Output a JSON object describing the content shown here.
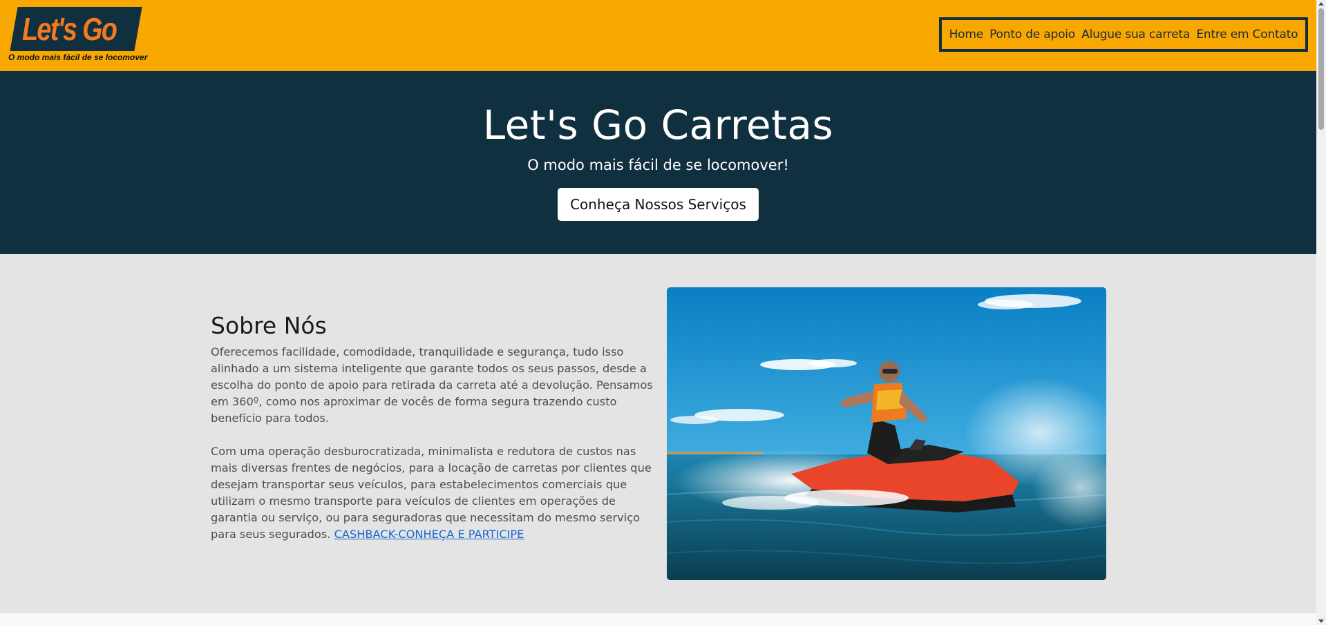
{
  "brand": {
    "logo_text": "Let's Go",
    "logo_tagline": "O modo mais fácil de se locomover",
    "colors": {
      "header_bg": "#f8a800",
      "dark": "#10303f",
      "logo_orange": "#f47a20",
      "section_bg": "#e4e4e4",
      "link": "#1967d2"
    }
  },
  "nav": {
    "items": [
      {
        "label": "Home"
      },
      {
        "label": "Ponto de apoio"
      },
      {
        "label": "Alugue sua carreta"
      },
      {
        "label": "Entre em Contato"
      }
    ]
  },
  "hero": {
    "title": "Let's Go Carretas",
    "subtitle": "O modo mais fácil de se locomover!",
    "cta_label": "Conheça Nossos Serviços"
  },
  "about": {
    "heading": "Sobre Nós",
    "paragraph_1": "Oferecemos facilidade, comodidade, tranquilidade e segurança, tudo isso alinhado a um sistema inteligente que garante todos os seus passos, desde a escolha do ponto de apoio para retirada da carreta até a devolução. Pensamos em 360º, como nos aproximar de vocês de forma segura trazendo custo benefício para todos.",
    "paragraph_2": "Com uma operação desburocratizada, minimalista e redutora de custos nas mais diversas frentes de negócios, para a locação de carretas por clientes que desejam transportar seus veículos, para estabelecimentos comerciais que utilizam o mesmo transporte para veículos de clientes em operações de garantia ou serviço, ou para seguradoras que necessitam do mesmo serviço para seus segurados.",
    "cashback_link": "CASHBACK-CONHEÇA E PARTICIPE",
    "image_icon": "jet-ski-photo"
  }
}
